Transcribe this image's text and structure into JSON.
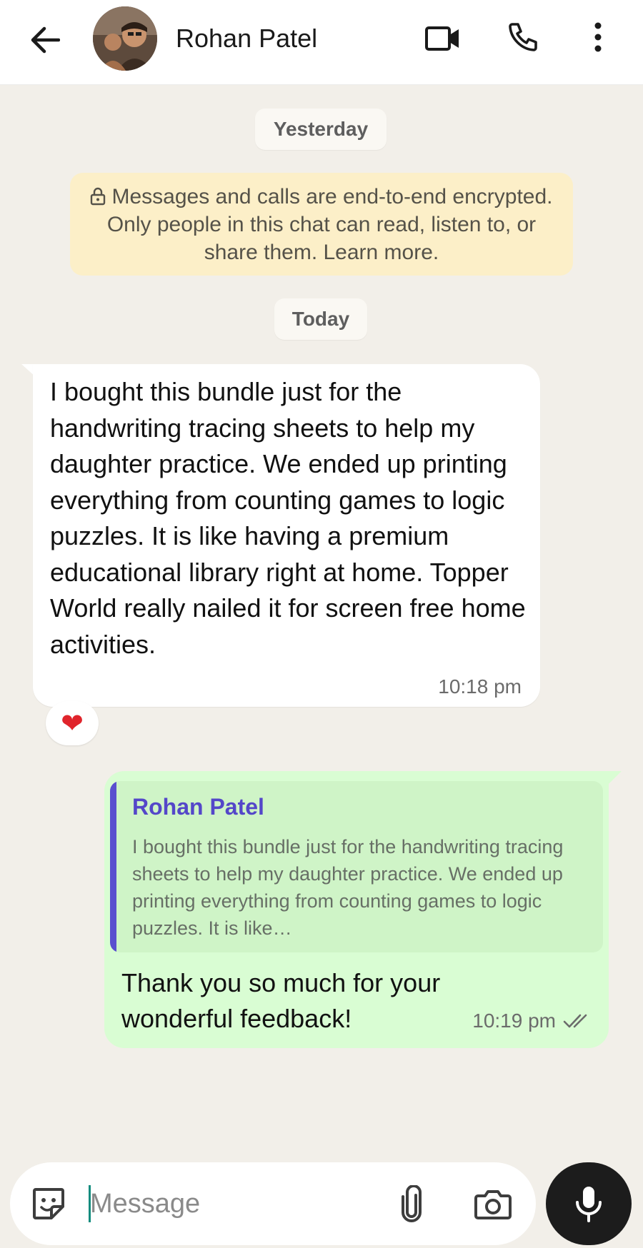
{
  "header": {
    "contact_name": "Rohan Patel",
    "icons": {
      "back": "arrow-left-icon",
      "video": "video-camera-icon",
      "phone": "phone-icon",
      "more": "more-vertical-icon"
    }
  },
  "chat": {
    "date_separators": [
      "Yesterday",
      "Today"
    ],
    "encryption_notice": "Messages and calls are end-to-end encrypted. Only people in this chat can read, listen to, or share them. Learn more.",
    "messages": [
      {
        "direction": "incoming",
        "text": "I bought this bundle just for the handwriting tracing sheets to help my daughter practice. We ended up printing everything from counting games to logic puzzles. It is like having a premium educational library right at home. Topper World really nailed it for screen free home activities.",
        "time": "10:18 pm",
        "reaction": "❤"
      },
      {
        "direction": "outgoing",
        "quote": {
          "author": "Rohan Patel",
          "text": "I bought this bundle just for the handwriting tracing sheets to help my daughter practice. We ended up printing everything from counting games to logic puzzles. It is like…"
        },
        "text": "Thank you so much for your wonderful feedback!",
        "time": "10:19 pm",
        "status": "read"
      }
    ]
  },
  "composer": {
    "placeholder": "Message",
    "value": "",
    "icons": {
      "sticker": "sticker-icon",
      "attach": "paperclip-icon",
      "camera": "camera-icon",
      "mic": "microphone-icon"
    }
  },
  "colors": {
    "chat_background": "#f2efe9",
    "outgoing_bubble": "#d9fdd3",
    "quote_accent": "#5a4fcf",
    "encryption_notice": "#fcefc8",
    "mic_button": "#1c1c1c"
  }
}
